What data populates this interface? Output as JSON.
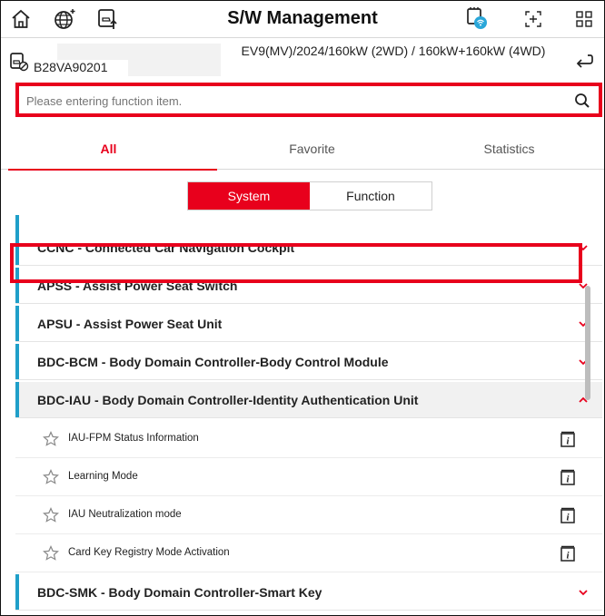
{
  "header": {
    "title": "S/W Management",
    "icons": [
      "home-icon",
      "globe-icon",
      "vehicle-upload-icon",
      "ccnc-device-icon",
      "scan-icon",
      "apps-grid-icon"
    ]
  },
  "vehicle": {
    "id": "B28VA90201",
    "model": "EV9(MV)/2024/160kW (2WD) / 160kW+160kW (4WD)"
  },
  "search": {
    "placeholder": "Please entering function item."
  },
  "tabs": [
    {
      "label": "All",
      "active": true
    },
    {
      "label": "Favorite",
      "active": false
    },
    {
      "label": "Statistics",
      "active": false
    }
  ],
  "segment": [
    {
      "label": "System",
      "active": true
    },
    {
      "label": "Function",
      "active": false
    }
  ],
  "systems": [
    {
      "label": "CCNC - Connected Car Navigation Cockpit",
      "expanded": false
    },
    {
      "label": "APSS - Assist Power Seat Switch",
      "expanded": false
    },
    {
      "label": "APSU - Assist Power Seat Unit",
      "expanded": false
    },
    {
      "label": "BDC-BCM - Body Domain Controller-Body Control Module",
      "expanded": false
    },
    {
      "label": "BDC-IAU - Body Domain Controller-Identity Authentication Unit",
      "expanded": true
    },
    {
      "label": "BDC-SMK - Body Domain Controller-Smart Key",
      "expanded": false
    }
  ],
  "functions": [
    {
      "label": "IAU-FPM Status Information",
      "highlighted": false
    },
    {
      "label": "Learning Mode",
      "highlighted": true
    },
    {
      "label": "IAU Neutralization mode",
      "highlighted": false
    },
    {
      "label": "Card Key Registry Mode Activation",
      "highlighted": false
    }
  ],
  "colors": {
    "accent": "#e8001c",
    "system_bar": "#1f9fc9"
  }
}
